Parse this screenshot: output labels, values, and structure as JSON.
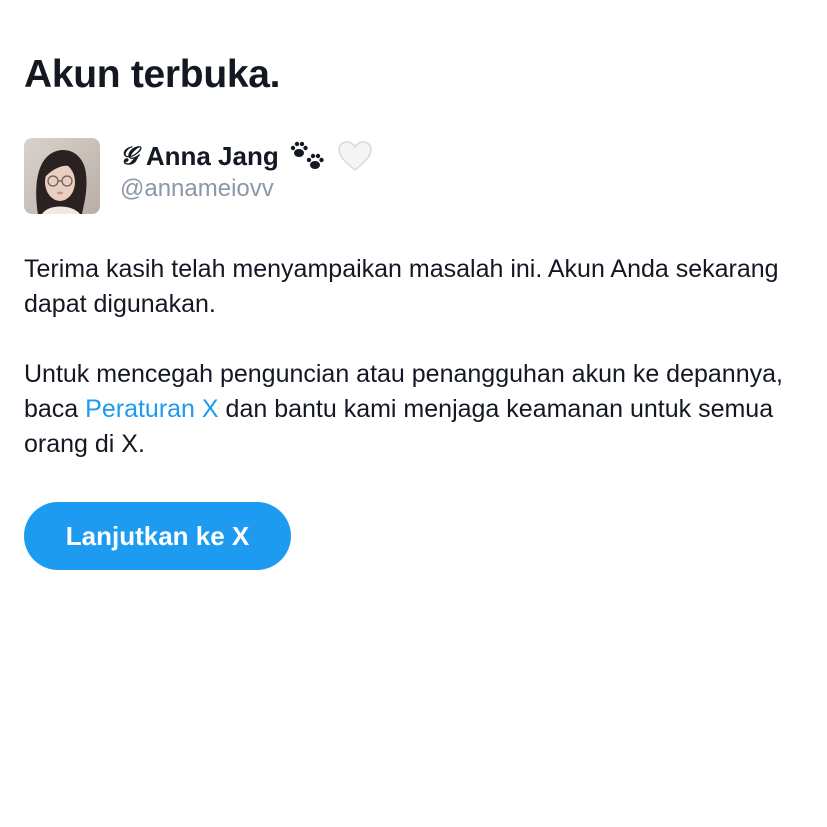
{
  "page": {
    "title": "Akun terbuka."
  },
  "user": {
    "name_prefix": "𝒢",
    "display_name": "Anna Jang",
    "name_emojis": [
      "paw-prints-icon",
      "white-heart-icon"
    ],
    "handle": "@annameiovv"
  },
  "message": {
    "paragraph1": "Terima kasih telah menyampaikan masalah ini. Akun Anda sekarang dapat digunakan.",
    "paragraph2_before_link": "Untuk mencegah penguncian atau penangguhan akun ke depannya, baca ",
    "rules_link_text": "Peraturan X",
    "paragraph2_after_link": " dan bantu kami menjaga keamanan untuk semua orang di X."
  },
  "button": {
    "continue_label": "Lanjutkan ke X"
  },
  "colors": {
    "accent": "#1d9bf0",
    "text_primary": "#141823",
    "text_secondary": "#8b98a5",
    "background": "#ffffff"
  }
}
